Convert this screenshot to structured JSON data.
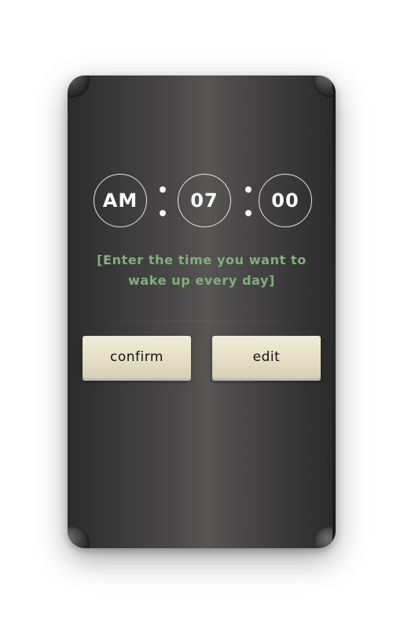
{
  "time": {
    "period": "AM",
    "hour": "07",
    "minute": "00"
  },
  "hint": "[Enter the time you want to wake up every day]",
  "buttons": {
    "confirm_label": "confirm",
    "edit_label": "edit"
  },
  "colors": {
    "panel": "#4a4848",
    "hint_text": "#7fb27a",
    "button_face": "#e6dfc6"
  }
}
